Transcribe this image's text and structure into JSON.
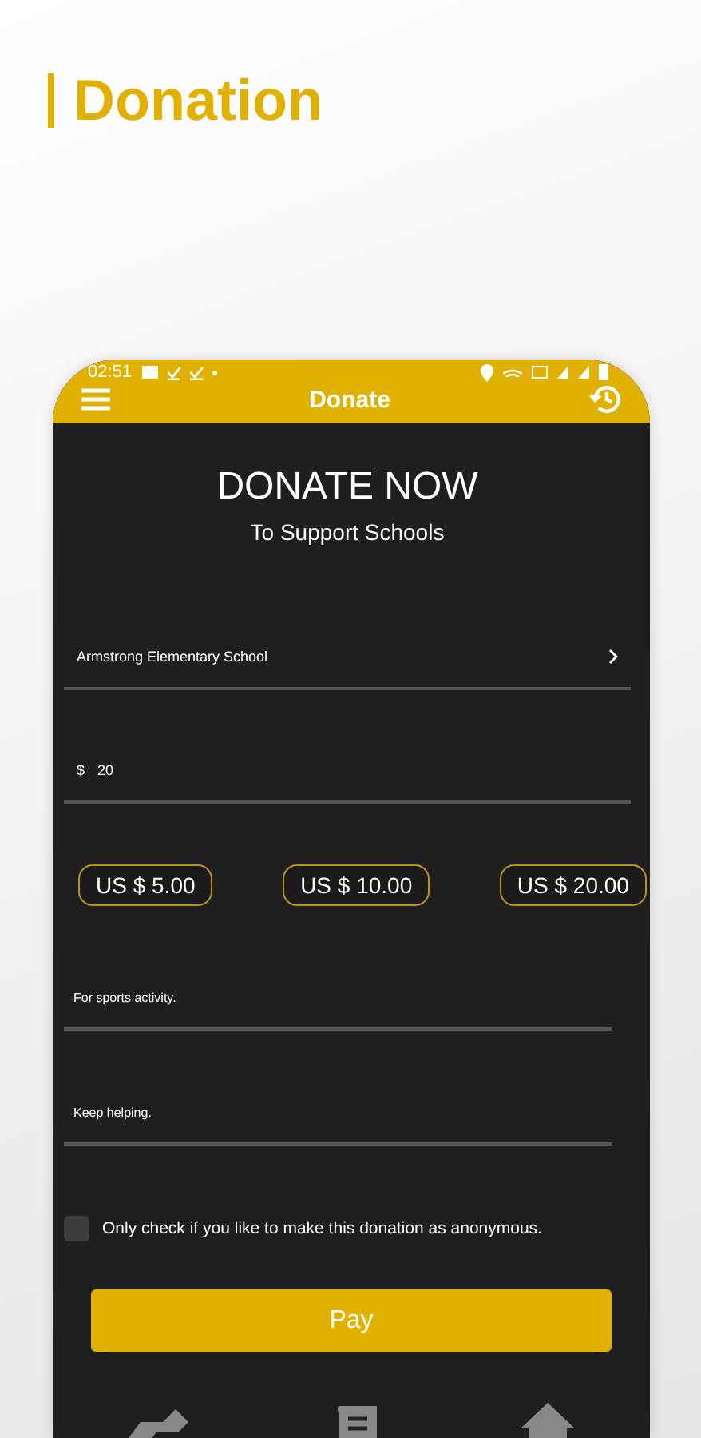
{
  "banner": {
    "title": "Donation"
  },
  "status_bar": {
    "time": "02:51"
  },
  "app_bar": {
    "title": "Donate"
  },
  "header": {
    "title": "DONATE NOW",
    "subtitle": "To Support Schools"
  },
  "school": {
    "value": "Armstrong Elementary School"
  },
  "amount": {
    "prefix": "$",
    "value": "20"
  },
  "presets": [
    {
      "label": "US $ 5.00",
      "selected": false
    },
    {
      "label": "US $ 10.00",
      "selected": false
    },
    {
      "label": "US $ 20.00",
      "selected": false
    }
  ],
  "notes": [
    {
      "value": "For sports activity."
    },
    {
      "value": "Keep helping."
    }
  ],
  "anonymous": {
    "label": "Only check if you like to make this donation as anonymous.",
    "checked": false
  },
  "pay_button": {
    "label": "Pay"
  }
}
